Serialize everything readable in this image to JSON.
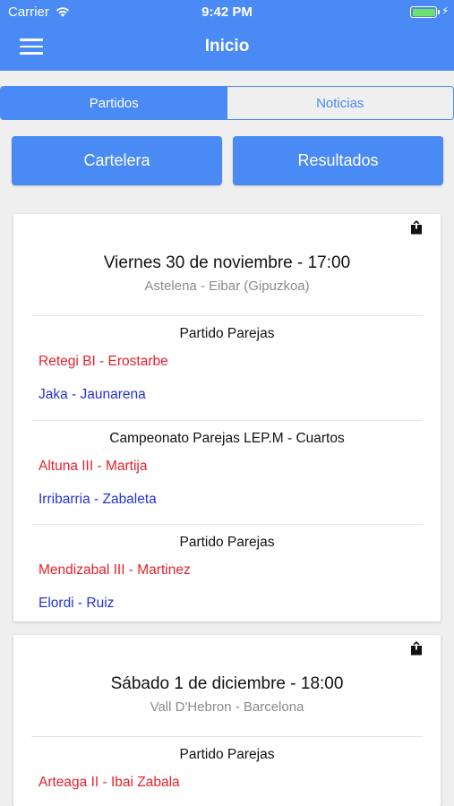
{
  "status_bar": {
    "carrier": "Carrier",
    "time": "9:42 PM"
  },
  "nav": {
    "title": "Inicio"
  },
  "tabs": [
    {
      "label": "Partidos",
      "active": true
    },
    {
      "label": "Noticias",
      "active": false
    }
  ],
  "buttons": {
    "cartelera": "Cartelera",
    "resultados": "Resultados"
  },
  "events": [
    {
      "date": "Viernes 30 de noviembre - 17:00",
      "venue": "Astelena - Eibar (Gipuzkoa)",
      "matches": [
        {
          "title": "Partido Parejas",
          "team_red": "Retegi BI - Erostarbe",
          "team_blue": "Jaka - Jaunarena"
        },
        {
          "title": "Campeonato Parejas LEP.M - Cuartos",
          "team_red": "Altuna III - Martija",
          "team_blue": "Irribarria - Zabaleta"
        },
        {
          "title": "Partido Parejas",
          "team_red": "Mendizabal III - Martinez",
          "team_blue": "Elordi - Ruiz"
        }
      ]
    },
    {
      "date": "Sábado 1 de diciembre - 18:00",
      "venue": "Vall D'Hebron - Barcelona",
      "matches": [
        {
          "title": "Partido Parejas",
          "team_red": "Arteaga II - Ibai Zabala"
        }
      ]
    }
  ],
  "colors": {
    "accent": "#4a8af4",
    "team_red": "#e6202c",
    "team_blue": "#2233d6",
    "venue_gray": "#8a8a8a"
  }
}
